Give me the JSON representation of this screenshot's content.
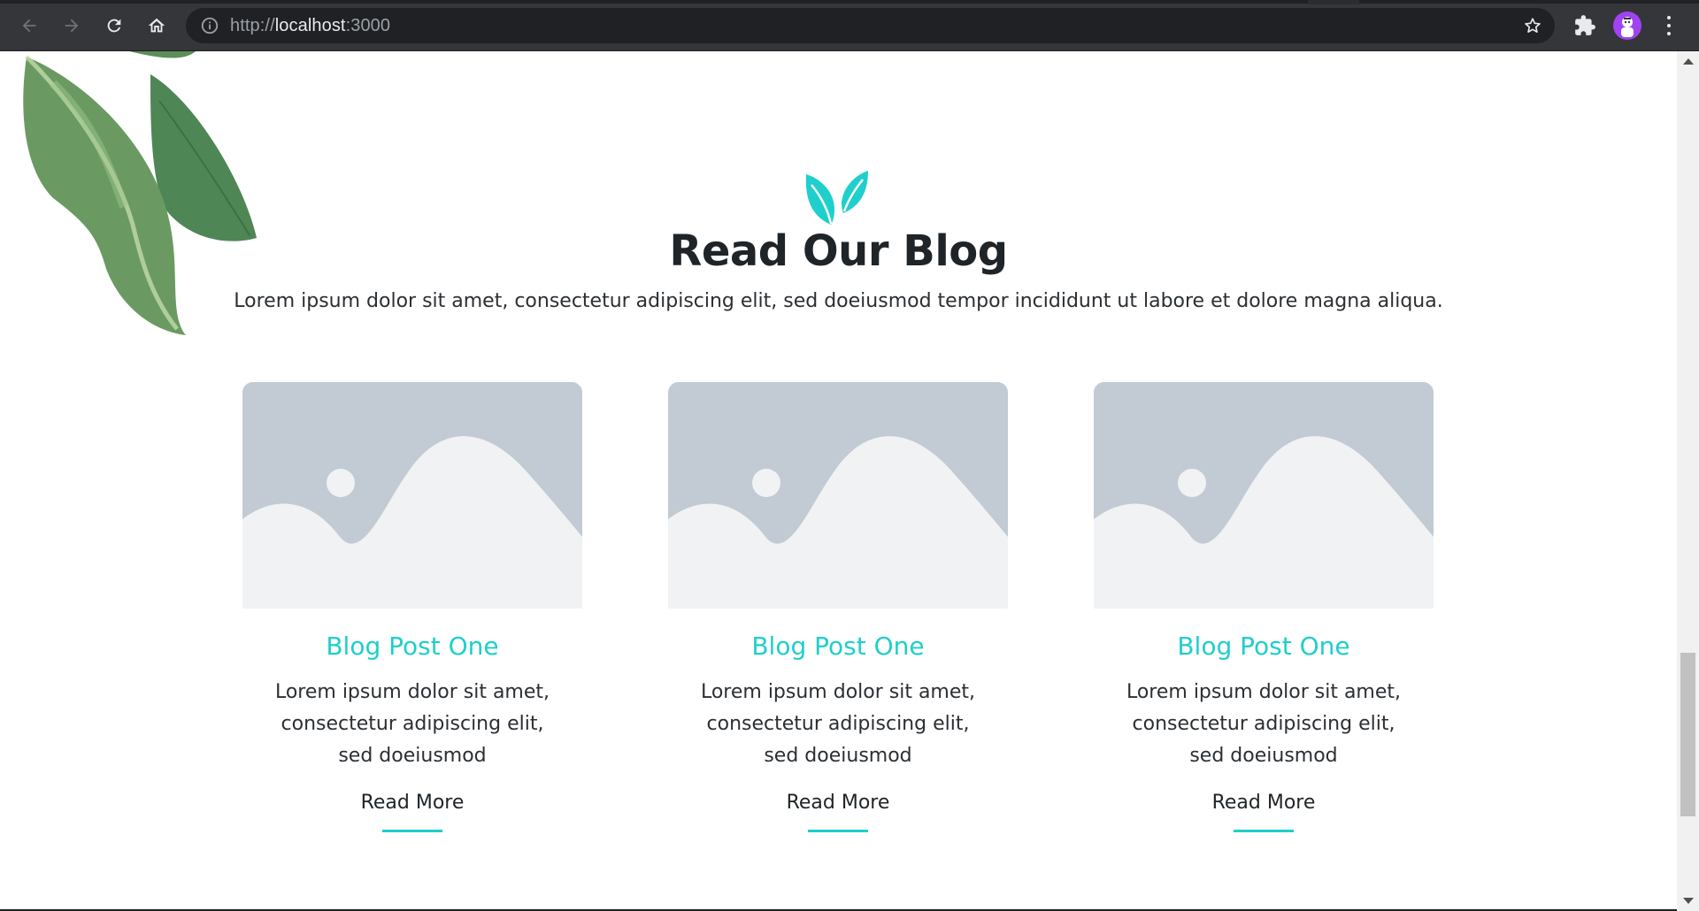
{
  "browser": {
    "url_scheme": "http://",
    "url_host": "localhost",
    "url_port": ":3000"
  },
  "blog": {
    "title": "Read Our Blog",
    "subtitle": "Lorem ipsum dolor sit amet, consectetur adipiscing elit, sed doeiusmod tempor incididunt ut labore et dolore magna aliqua.",
    "posts": [
      {
        "title": "Blog Post One",
        "excerpt": "Lorem ipsum dolor sit amet, consectetur adipiscing elit, sed doeiusmod",
        "link": "Read More"
      },
      {
        "title": "Blog Post One",
        "excerpt": "Lorem ipsum dolor sit amet, consectetur adipiscing elit, sed doeiusmod",
        "link": "Read More"
      },
      {
        "title": "Blog Post One",
        "excerpt": "Lorem ipsum dolor sit amet, consectetur adipiscing elit, sed doeiusmod",
        "link": "Read More"
      }
    ]
  },
  "colors": {
    "accent": "#1fcfcb",
    "placeholder_bg": "#c2cbd3",
    "placeholder_fg": "#f1f2f3",
    "chrome_bg": "#35363a"
  },
  "icons": [
    "back-arrow-icon",
    "forward-arrow-icon",
    "reload-icon",
    "home-icon",
    "info-icon",
    "star-icon",
    "extensions-icon",
    "avatar",
    "kebab-menu-icon",
    "leaf-icon",
    "image-placeholder-icon"
  ]
}
